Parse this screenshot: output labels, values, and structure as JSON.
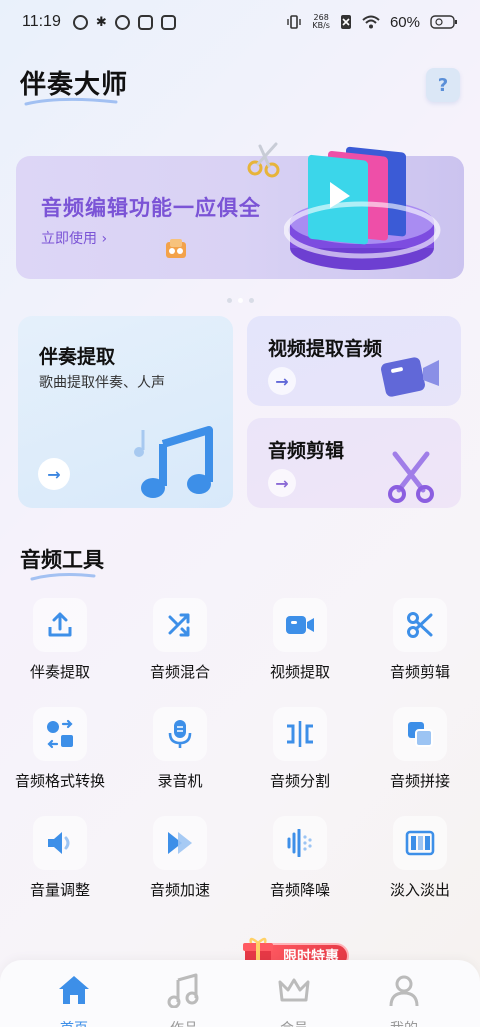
{
  "status_bar": {
    "time": "11:19",
    "net_speed_top": "268",
    "net_speed_bottom": "KB/s",
    "battery": "60%"
  },
  "header": {
    "title": "伴奏大师",
    "help_label": "?"
  },
  "banner": {
    "title": "音频编辑功能一应俱全",
    "cta": "立即使用 ›"
  },
  "cards": {
    "accompaniment": {
      "title": "伴奏提取",
      "subtitle": "歌曲提取伴奏、人声",
      "arrow": "→"
    },
    "video_audio": {
      "title": "视频提取音频",
      "arrow": "→"
    },
    "audio_edit": {
      "title": "音频剪辑",
      "arrow": "→"
    }
  },
  "tools_section": {
    "title": "音频工具",
    "items": [
      {
        "label": "伴奏提取",
        "icon": "upload-icon"
      },
      {
        "label": "音频混合",
        "icon": "shuffle-icon"
      },
      {
        "label": "视频提取",
        "icon": "video-camera-icon"
      },
      {
        "label": "音频剪辑",
        "icon": "scissors-icon"
      },
      {
        "label": "音频格式转换",
        "icon": "format-convert-icon"
      },
      {
        "label": "录音机",
        "icon": "microphone-icon"
      },
      {
        "label": "音频分割",
        "icon": "split-icon"
      },
      {
        "label": "音频拼接",
        "icon": "merge-icon"
      },
      {
        "label": "音量调整",
        "icon": "volume-icon"
      },
      {
        "label": "音频加速",
        "icon": "speed-icon"
      },
      {
        "label": "音频降噪",
        "icon": "denoise-icon"
      },
      {
        "label": "淡入淡出",
        "icon": "fade-icon"
      }
    ]
  },
  "promo": {
    "label": "限时特惠"
  },
  "bottom_nav": {
    "items": [
      {
        "label": "首页",
        "icon": "home-icon",
        "active": true
      },
      {
        "label": "作品",
        "icon": "music-note-icon",
        "active": false
      },
      {
        "label": "会员",
        "icon": "crown-icon",
        "active": false
      },
      {
        "label": "我的",
        "icon": "person-icon",
        "active": false
      }
    ]
  },
  "colors": {
    "accent_blue": "#3d8fe8",
    "banner_purple": "#7b54d6",
    "promo_red": "#e63946"
  }
}
